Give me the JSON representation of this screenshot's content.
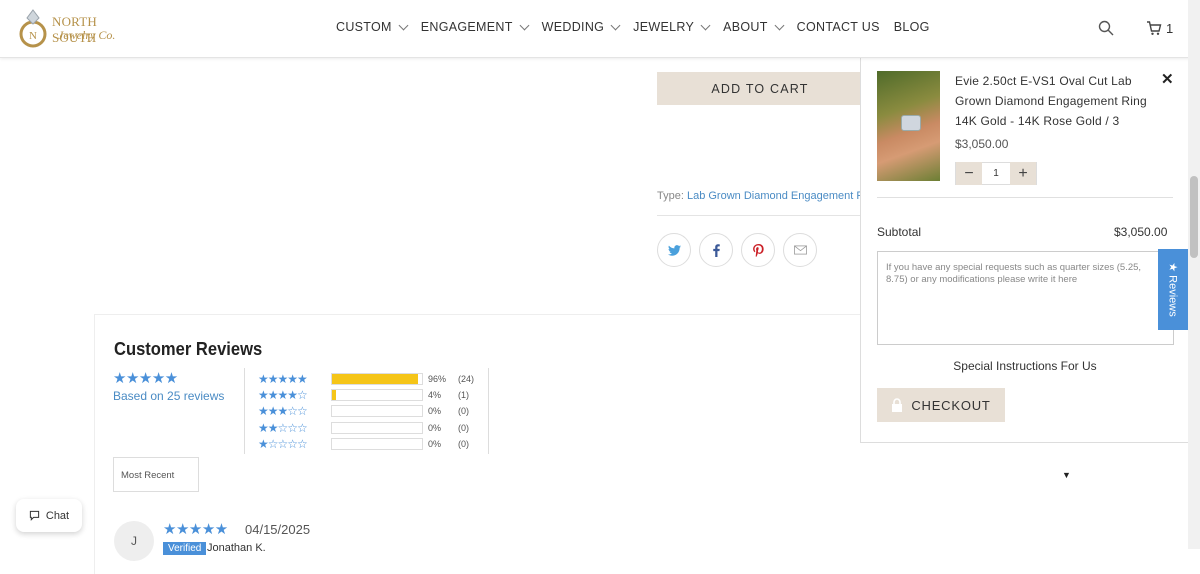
{
  "header": {
    "logo_line1": "NORTH SOUTH",
    "logo_line2": "Jewelry Co.",
    "nav": [
      {
        "label": "CUSTOM",
        "has_dropdown": true
      },
      {
        "label": "ENGAGEMENT",
        "has_dropdown": true
      },
      {
        "label": "WEDDING",
        "has_dropdown": true
      },
      {
        "label": "JEWELRY",
        "has_dropdown": true
      },
      {
        "label": "ABOUT",
        "has_dropdown": true
      },
      {
        "label": "CONTACT US",
        "has_dropdown": false
      },
      {
        "label": "BLOG",
        "has_dropdown": false
      }
    ],
    "cart_count": "1"
  },
  "product": {
    "add_to_cart": "ADD TO CART",
    "type_label": "Type:",
    "type_value": "Lab Grown Diamond Engagement Rings"
  },
  "share": {
    "icons": [
      "twitter-icon",
      "facebook-icon",
      "pinterest-icon",
      "email-icon"
    ]
  },
  "reviews": {
    "title": "Customer Reviews",
    "overall_stars": "★★★★★",
    "based_on": "Based on 25 reviews",
    "histogram": [
      {
        "stars": "★★★★★",
        "fill": 0.96,
        "pct": "96%",
        "count": "(24)"
      },
      {
        "stars": "★★★★☆",
        "fill": 0.04,
        "pct": "4%",
        "count": "(1)"
      },
      {
        "stars": "★★★☆☆",
        "fill": 0,
        "pct": "0%",
        "count": "(0)"
      },
      {
        "stars": "★★☆☆☆",
        "fill": 0,
        "pct": "0%",
        "count": "(0)"
      },
      {
        "stars": "★☆☆☆☆",
        "fill": 0,
        "pct": "0%",
        "count": "(0)"
      }
    ],
    "sort_value": "Most Recent",
    "first_review": {
      "initial": "J",
      "stars": "★★★★★",
      "date": "04/15/2025",
      "verified": "Verified",
      "name": "Jonathan K."
    }
  },
  "chat": {
    "label": "Chat"
  },
  "cart_drawer": {
    "product_title": "Evie 2.50ct E-VS1 Oval Cut Lab Grown Diamond Engagement Ring 14K Gold - 14K Rose Gold / 3",
    "price": "$3,050.00",
    "quantity": "1",
    "subtotal_label": "Subtotal",
    "subtotal_value": "$3,050.00",
    "notes_placeholder": "If you have any special requests such as quarter sizes (5.25, 8.75) or any modifications please write it here",
    "instructions_label": "Special Instructions For Us",
    "checkout_label": "CHECKOUT"
  },
  "reviews_tab": {
    "label": "★ Reviews"
  },
  "colors": {
    "accent_blue": "#4a90d9",
    "button_beige": "#e8e0d6",
    "star_yellow": "#f5c518",
    "brand_gold": "#b6924a"
  }
}
